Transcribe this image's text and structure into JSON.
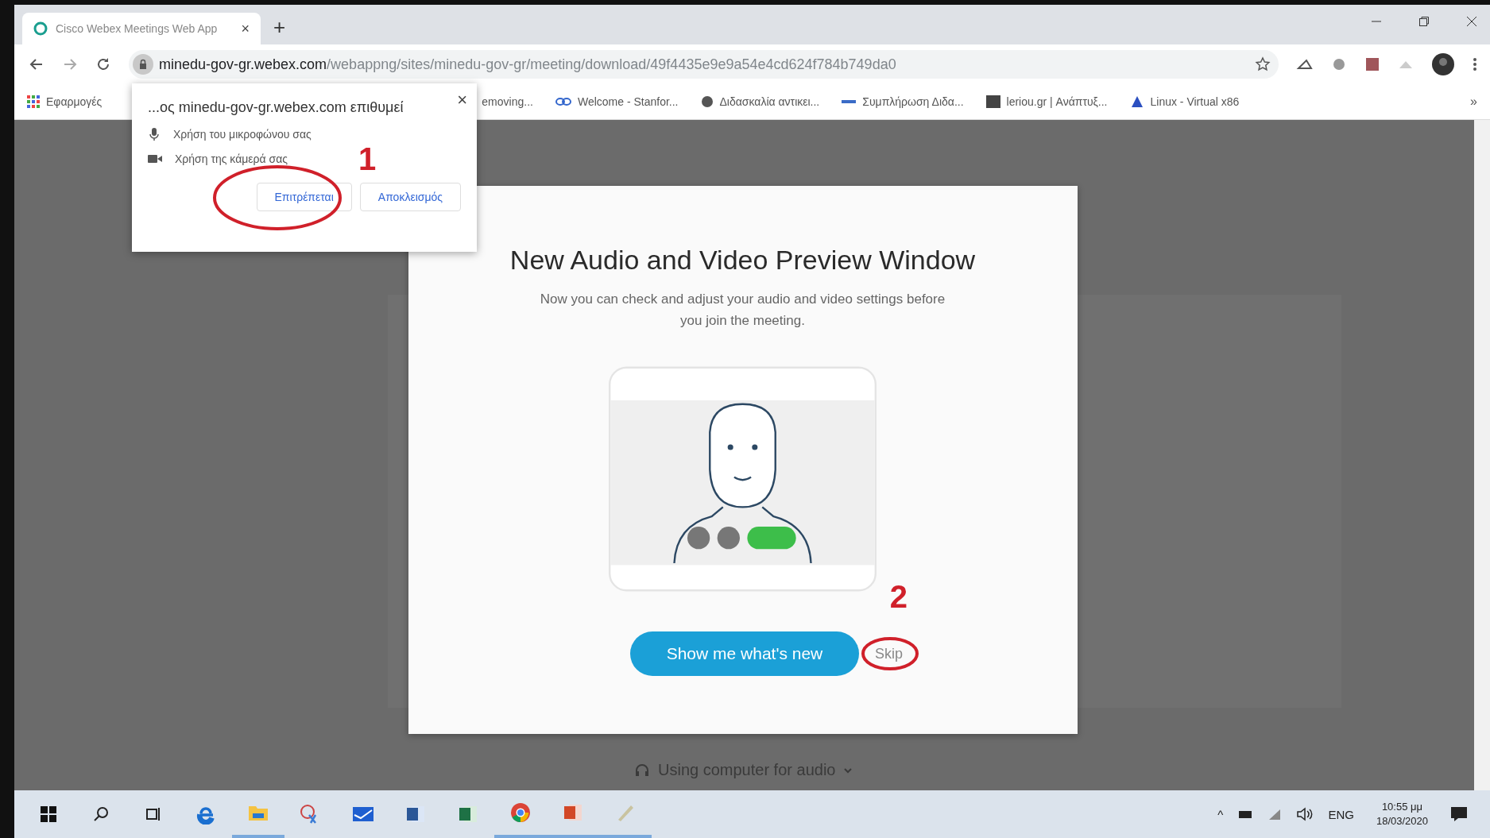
{
  "browser": {
    "tab": {
      "title": "Cisco Webex Meetings Web App",
      "close": "×"
    },
    "new_tab": "+",
    "address": {
      "domain": "minedu-gov-gr.webex.com",
      "path": "/webappng/sites/minedu-gov-gr/meeting/download/49f4435e9e9a54e4cd624f784b749da0"
    },
    "bookmarks": [
      {
        "label": "Εφαρμογές",
        "kind": "apps"
      },
      {
        "label": "emoving...",
        "kind": "none"
      },
      {
        "label": "Welcome - Stanfor...",
        "kind": "link"
      },
      {
        "label": "Διδασκαλία αντικει...",
        "kind": "globe"
      },
      {
        "label": "Συμπλήρωση Διδα...",
        "kind": "dash"
      },
      {
        "label": "leriou.gr | Ανάπτυξ...",
        "kind": "page"
      },
      {
        "label": "Linux - Virtual x86",
        "kind": "app"
      }
    ],
    "bookmarks_more": "»"
  },
  "permission_popup": {
    "title": "...ος minedu-gov-gr.webex.com επιθυμεί",
    "close": "×",
    "items": [
      {
        "label": "Χρήση του μικροφώνου σας",
        "kind": "mic"
      },
      {
        "label": "Χρήση της κάμερά σας",
        "kind": "camera"
      }
    ],
    "buttons": [
      "Επιτρέπεται",
      "Αποκλεισμός"
    ]
  },
  "dialog": {
    "title": "New Audio and Video Preview Window",
    "text": "Now you can check and adjust your audio and video settings before you join the meeting.",
    "primary_button": "Show me what's new",
    "skip_button": "Skip"
  },
  "audio_option": "Using computer for audio",
  "annotations": [
    {
      "number": "1"
    },
    {
      "number": "2"
    }
  ],
  "taskbar": {
    "apps": [
      {
        "kind": "windows",
        "running": false
      },
      {
        "kind": "search",
        "running": false
      },
      {
        "kind": "taskview",
        "running": false
      },
      {
        "kind": "edge",
        "running": false
      },
      {
        "kind": "explorer",
        "running": true
      },
      {
        "kind": "snip",
        "running": false
      },
      {
        "kind": "mail",
        "running": false
      },
      {
        "kind": "word",
        "running": false
      },
      {
        "kind": "excel",
        "running": false
      },
      {
        "kind": "chrome",
        "running": true
      },
      {
        "kind": "powerpoint",
        "running": true
      },
      {
        "kind": "tool",
        "running": true
      }
    ],
    "caret": "^",
    "language": "ENG",
    "time": "10:55 μμ",
    "date": "18/03/2020"
  }
}
